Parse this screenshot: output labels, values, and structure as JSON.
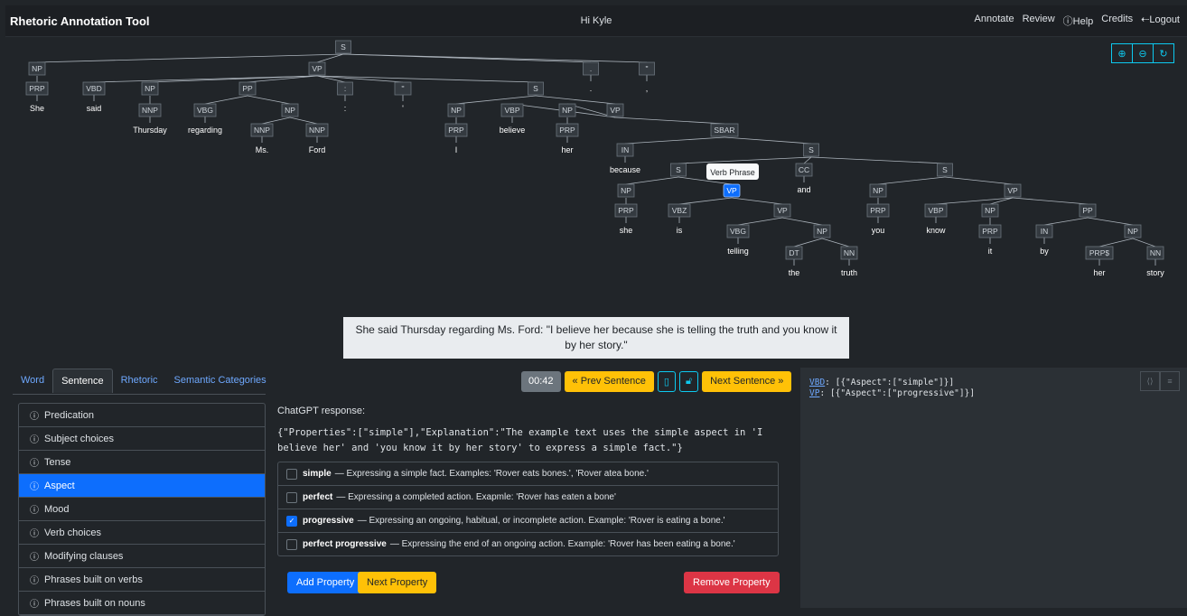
{
  "header": {
    "title": "Rhetoric Annotation Tool",
    "greeting": "Hi Kyle",
    "nav": [
      "Annotate",
      "Review",
      "Help",
      "Credits",
      "Logout"
    ]
  },
  "tree": {
    "tooltip": "Verb Phrase",
    "zoom_icons": [
      "zoom-in-icon",
      "zoom-out-icon",
      "reset-icon"
    ],
    "nodes": [
      [
        "S",
        ""
      ],
      [
        "NP",
        ""
      ],
      [
        "VP",
        ""
      ],
      [
        ".",
        "."
      ],
      [
        "\"",
        ","
      ],
      [
        "PRP",
        "She"
      ],
      [
        "VBD",
        "said"
      ],
      [
        "NP",
        ""
      ],
      [
        "PP",
        ""
      ],
      [
        ":",
        ":"
      ],
      [
        "''",
        "'"
      ],
      [
        "S",
        ""
      ],
      [
        "NNP",
        "Thursday"
      ],
      [
        "VBG",
        "regarding"
      ],
      [
        "NP",
        ""
      ],
      [
        "NNP",
        "Ms."
      ],
      [
        "NNP",
        "Ford"
      ],
      [
        "NP",
        ""
      ],
      [
        "VP",
        ""
      ],
      [
        "PRP",
        "I"
      ],
      [
        "VBP",
        "believe"
      ],
      [
        "NP",
        ""
      ],
      [
        "PRP",
        "her"
      ],
      [
        "SBAR",
        ""
      ],
      [
        "IN",
        "because"
      ],
      [
        "S",
        ""
      ],
      [
        "S",
        ""
      ],
      [
        "CC",
        "and"
      ],
      [
        "S",
        ""
      ],
      [
        "NP",
        ""
      ],
      [
        "VP",
        ""
      ],
      [
        "PRP",
        "she"
      ],
      [
        "VBZ",
        "is"
      ],
      [
        "VP",
        ""
      ],
      [
        "VBG",
        "telling"
      ],
      [
        "NP",
        ""
      ],
      [
        "DT",
        "the"
      ],
      [
        "NN",
        "truth"
      ],
      [
        "NP",
        ""
      ],
      [
        "VP",
        ""
      ],
      [
        "PRP",
        "you"
      ],
      [
        "VBP",
        "know"
      ],
      [
        "NP",
        ""
      ],
      [
        "PRP",
        "it"
      ],
      [
        "PP",
        ""
      ],
      [
        "IN",
        "by"
      ],
      [
        "NP",
        ""
      ],
      [
        "PRP$",
        "her"
      ],
      [
        "NN",
        "story"
      ]
    ]
  },
  "sentence": "She said Thursday regarding Ms. Ford: \"I believe her because she is telling the truth and you know it by her story.\"",
  "tabs": [
    "Word",
    "Sentence",
    "Rhetoric",
    "Semantic Categories"
  ],
  "controls": {
    "timer": "00:42",
    "prev": "« Prev Sentence",
    "next": "Next Sentence »"
  },
  "categories": [
    "Predication",
    "Subject choices",
    "Tense",
    "Aspect",
    "Mood",
    "Verb choices",
    "Modifying clauses",
    "Phrases built on verbs",
    "Phrases built on nouns"
  ],
  "response": {
    "title": "ChatGPT response:",
    "text": "{\"Properties\":[\"simple\"],\"Explanation\":\"The example text uses the simple aspect in 'I believe her' and 'you know it by her story' to express a simple fact.\"}"
  },
  "properties": [
    {
      "name": "simple",
      "desc": "— Expressing a simple fact. Examples: 'Rover eats bones.', 'Rover atea bone.'",
      "checked": false
    },
    {
      "name": "perfect",
      "desc": "— Expressing a completed action. Exapmle: 'Rover has eaten a bone'",
      "checked": false
    },
    {
      "name": "progressive",
      "desc": "— Expressing an ongoing, habitual, or incomplete action. Example: 'Rover is eating a bone.'",
      "checked": true
    },
    {
      "name": "perfect progressive",
      "desc": "— Expressing the end of an ongoing action. Example: 'Rover has been eating a bone.'",
      "checked": false
    }
  ],
  "buttons": {
    "add": "Add Property",
    "next_prop": "Next Property",
    "remove": "Remove Property"
  },
  "code": {
    "line1_key": "VBD",
    "line1_val": ": [{\"Aspect\":[\"simple\"]}]",
    "line2_key": "VP",
    "line2_val": ": [{\"Aspect\":[\"progressive\"]}]"
  },
  "colors": {
    "accent": "#0d6efd",
    "warning": "#ffc107",
    "danger": "#dc3545",
    "info": "#0dcaf0"
  }
}
